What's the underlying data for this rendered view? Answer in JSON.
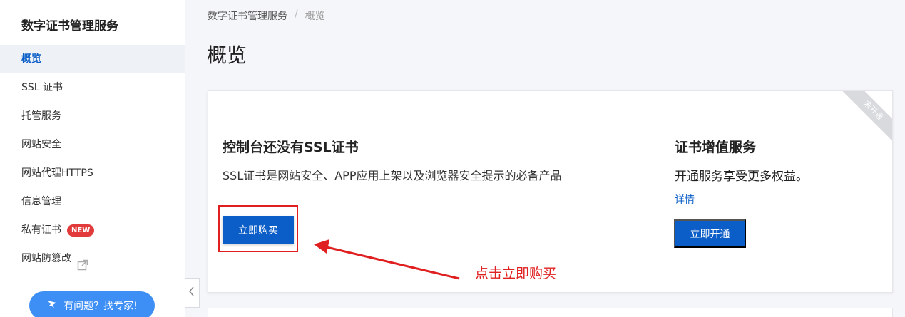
{
  "sidebar": {
    "title": "数字证书管理服务",
    "items": [
      {
        "label": "概览",
        "active": true
      },
      {
        "label": "SSL 证书"
      },
      {
        "label": "托管服务"
      },
      {
        "label": "网站安全"
      },
      {
        "label": "网站代理HTTPS"
      },
      {
        "label": "信息管理"
      },
      {
        "label": "私有证书",
        "badge": "NEW"
      },
      {
        "label": "网站防篡改",
        "icon": "external-link-icon"
      }
    ],
    "help_button": "有问题？找专家!"
  },
  "breadcrumb": {
    "root": "数字证书管理服务",
    "separator": "/",
    "current": "概览"
  },
  "page_title": "概览",
  "card": {
    "ribbon": "未开通",
    "left": {
      "title": "控制台还没有SSL证书",
      "desc": "SSL证书是网站安全、APP应用上架以及浏览器安全提示的必备产品",
      "button": "立即购买"
    },
    "right": {
      "title": "证书增值服务",
      "desc": "开通服务享受更多权益。",
      "link": "详情",
      "button": "立即开通"
    }
  },
  "annotation": "点击立即购买",
  "colors": {
    "primary": "#0b5ec7",
    "annotation_red": "#e02020",
    "help_blue": "#3e8ff5",
    "badge_red": "#e13b3b"
  }
}
